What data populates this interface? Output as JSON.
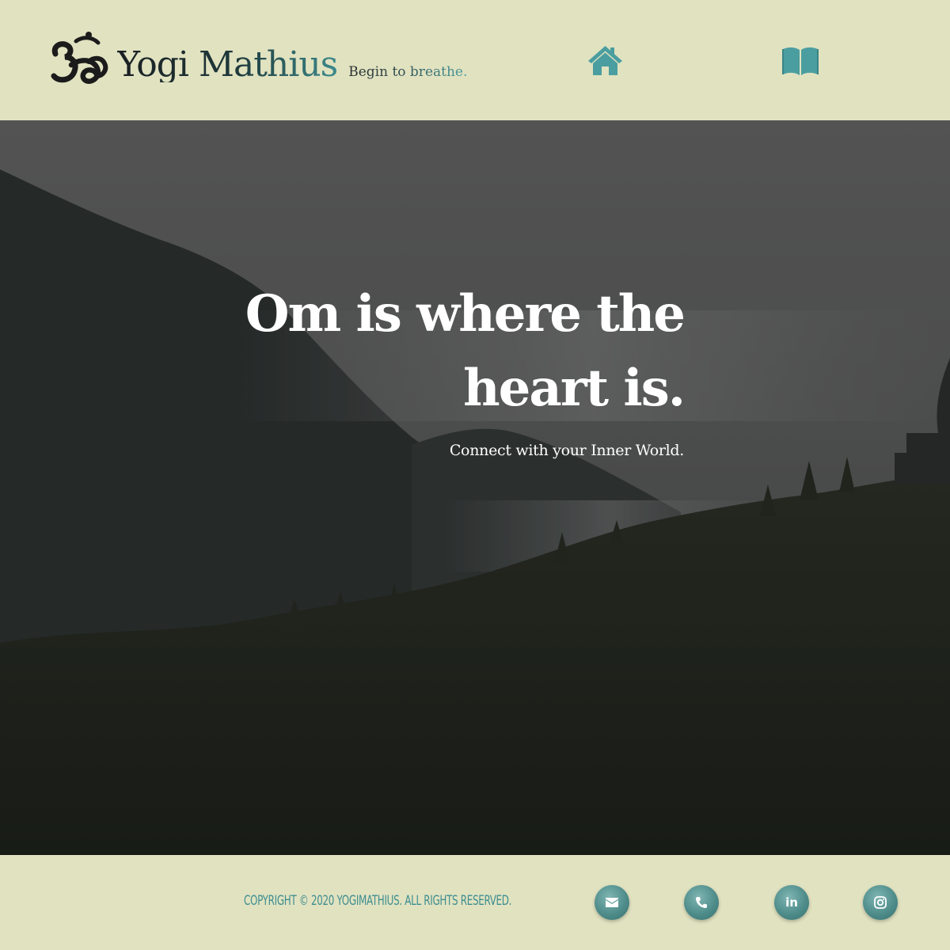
{
  "header": {
    "brand_name": "Yogi Mathius",
    "tagline": "Begin to breathe.",
    "nav": [
      {
        "name": "home",
        "icon": "home-icon"
      },
      {
        "name": "book",
        "icon": "book-icon"
      }
    ]
  },
  "hero": {
    "title_line1": "Om is where the",
    "title_line2": "heart is.",
    "subtitle": "Connect with your Inner World."
  },
  "footer": {
    "copyright": "COPYRIGHT © 2020 YOGIMATHIUS. ALL RIGHTS RESERVED.",
    "social": [
      {
        "name": "email",
        "icon": "envelope-icon"
      },
      {
        "name": "phone",
        "icon": "phone-icon"
      },
      {
        "name": "linkedin",
        "icon": "linkedin-icon",
        "label": "in"
      },
      {
        "name": "instagram",
        "icon": "instagram-icon"
      }
    ]
  },
  "colors": {
    "background": "#e1e2c0",
    "accent": "#3d8e90",
    "icon_teal": "#4b9ea0",
    "hero_text": "#ffffff"
  }
}
